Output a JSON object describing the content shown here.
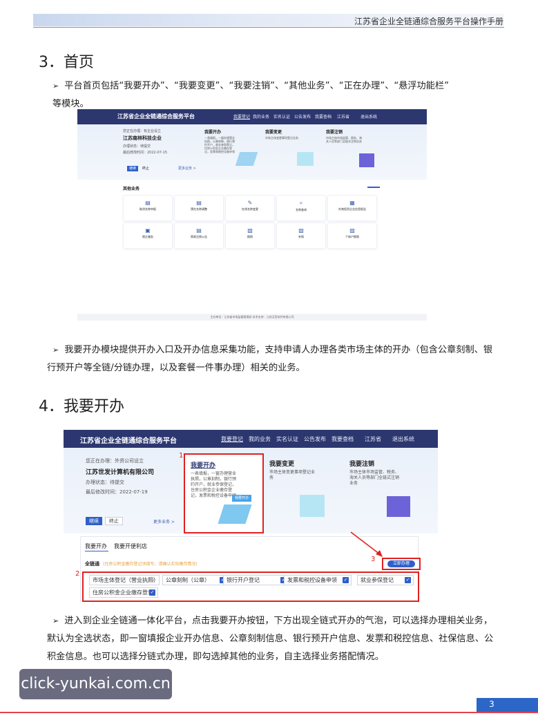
{
  "header": {
    "title": "江苏省企业全链通综合服务平台操作手册"
  },
  "section3": {
    "heading": "3．首页",
    "para1_line1": "平台首页包括“我要开办”、“我要变更”、“我要注销”、“其他业务”、“正在办理”、“悬浮功能栏”",
    "para1_line2": "等模块。",
    "para2_line1": "我要开办模块提供开办入口及开办信息采集功能，支持申请人办理各类市场主体的开办（包含公章刻制、银",
    "para2_line2": "行预开户等全链/分链办理，以及套餐一件事办理）相关的业务。"
  },
  "bullet": "➢",
  "shot1": {
    "brand": "江苏省企业全链通综合服务平台",
    "nav": [
      "我要登记",
      "我的业务",
      "实名认证",
      "公告发布",
      "我要查档",
      "江苏省",
      "退出系统"
    ],
    "status_label": "您正在办理：有企业设立",
    "company": "江苏南林科技企业",
    "status_line": "办理状态：待提交",
    "modified": "最后修改时间：2022-07-15",
    "btn_continue": "继续",
    "btn_stop": "终止",
    "more": "更多业务 >",
    "cards": [
      {
        "title": "我要开办",
        "desc": "一表填报，一窗办理营业执照，公章刻制，银行预约开户，就业参保登记，住房公积金企业缴存登记，发票和税控设备申领"
      },
      {
        "title": "我要变更",
        "desc": "市场主体变更事项登记业务"
      },
      {
        "title": "我要注销",
        "desc": "市场主体市场监管、税务、海关人员等部门全链式注销业务"
      }
    ],
    "other_title": "其他业务",
    "other_items": [
      "取消名称申报",
      "预先名称调整",
      "在线名称变更",
      "名称查询",
      "外商投资企业信息报告",
      "税企服务",
      "简易注销公告",
      "换照",
      "补照",
      "个体户换照"
    ],
    "footer": "主办单位：江苏省市场监督管理局    技术支持：江苏汉哲软件有限公司"
  },
  "section4": {
    "heading": "4．我要开办",
    "para_line1": "进入到企业全链通一体化平台，点击我要开办按钮，下方出现全链式开办的气泡，可以选择办理相关业务，",
    "para_line2": "默认为全选状态，即一窗填报企业开办信息、公章刻制信息、银行预开户信息、发票和税控信息、社保信息、公",
    "para_line3": "积金信息。也可以选择分链式办理，即勾选掉其他的业务，自主选择业务搭配情况。"
  },
  "shot2": {
    "brand": "江苏省企业全链通综合服务平台",
    "nav": [
      "我要登记",
      "我的业务",
      "实名认证",
      "公告发布",
      "我要查档",
      "江苏省",
      "退出系统"
    ],
    "status_label": "您正在办理：外资公司设立",
    "company": "江苏世发计算机有限公司",
    "status_line": "办理状态：待提交",
    "modified": "最后修改时间：2022-07-19",
    "btn_continue": "继续",
    "btn_stop": "终止",
    "more": "更多业务 >",
    "cards": [
      {
        "title": "我要开办",
        "desc": "一表填报，一窗办理营业执照，公章刻制，银行预约开户，就业参保登记，住房公积金企业缴存登记，发票和税控设备申领"
      },
      {
        "title": "我要变更",
        "desc": "市场主体变更事项登记业务"
      },
      {
        "title": "我要注销",
        "desc": "市场主体市场监管、税务、海关人员等部门全链式注销业务"
      }
    ],
    "card_caption": "我要开办",
    "tabs": [
      "我要开办",
      "我要开便利店"
    ],
    "all_chain": "全链通",
    "hint": "(住房公积金缴存登记须填写，请确认实际缴存情况)",
    "apply_btn": "立即办理",
    "options": [
      "市场主体登记（营业执照）",
      "公章刻制（公章）",
      "银行开户登记",
      "发票和税控设备申领",
      "就业参保登记",
      "住房公积金企业缴存登记"
    ],
    "nums": [
      "1",
      "2",
      "3"
    ]
  },
  "footer": {
    "page": "3"
  },
  "watermark": "click-yunkai.com.cn",
  "colors": {
    "nav": "#2c3770",
    "accent": "#2f5fc9",
    "highlight": "#e02020",
    "footer_blue": "#2c66c6",
    "footer_red": "#e0424e"
  }
}
